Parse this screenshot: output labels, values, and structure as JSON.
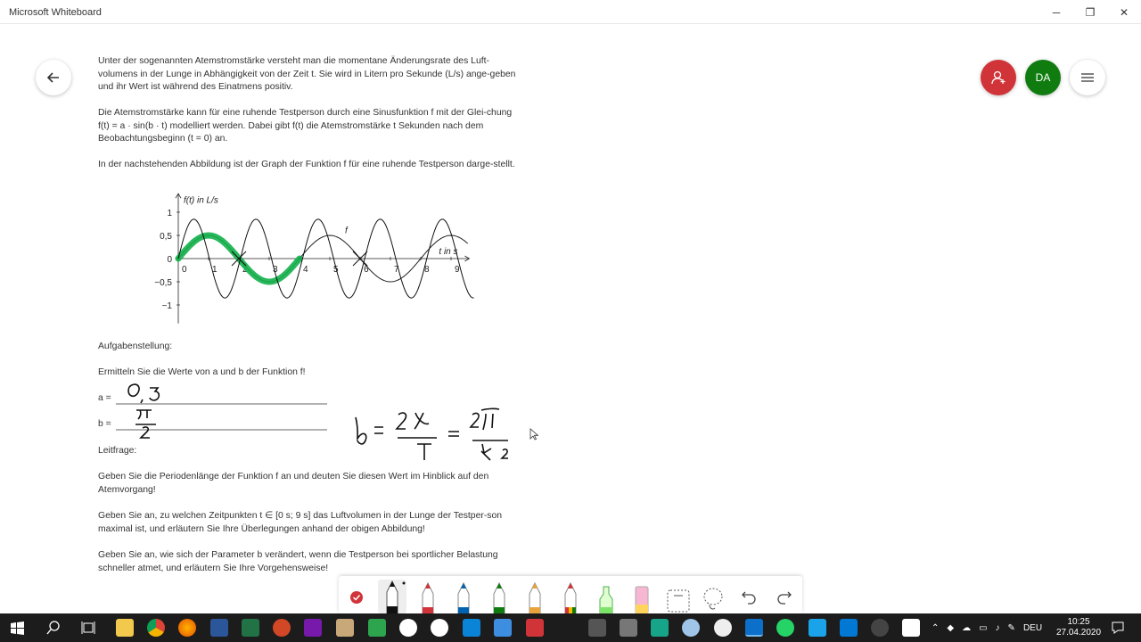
{
  "window": {
    "title": "Microsoft Whiteboard",
    "minimize": "─",
    "restore": "❐",
    "close": "✕"
  },
  "header": {
    "avatar_initials": "DA"
  },
  "doc": {
    "p1": "Unter der sogenannten Atemstromstärke versteht man die momentane Änderungsrate des Luft-volumens in der Lunge in Abhängigkeit von der Zeit t. Sie wird in Litern pro Sekunde (L/s) ange-geben und ihr Wert ist während des Einatmens positiv.",
    "p2": "Die Atemstromstärke kann für eine ruhende Testperson durch eine Sinusfunktion f mit der Glei-chung f(t) = a · sin(b · t) modelliert werden. Dabei gibt f(t) die Atemstromstärke t Sekunden nach dem Beobachtungsbeginn (t = 0) an.",
    "p3": "In der nachstehenden Abbildung ist der Graph der Funktion f für eine ruhende Testperson darge-stellt.",
    "task_heading": "Aufgabenstellung:",
    "task": "Ermitteln Sie die Werte von a und b der Funktion f!",
    "a_label": "a =",
    "b_label": "b =",
    "lead_heading": "Leitfrage:",
    "q1": "Geben Sie die Periodenlänge der Funktion f an und deuten Sie diesen Wert im Hinblick auf den Atemvorgang!",
    "q2": "Geben Sie an, zu welchen Zeitpunkten t ∈ [0 s; 9 s] das Luftvolumen in der Lunge der Testper-son maximal ist, und erläutern Sie Ihre Überlegungen anhand der obigen Abbildung!",
    "q3": "Geben Sie an, wie sich der Parameter b verändert, wenn die Testperson bei sportlicher Belastung schneller atmet, und erläutern Sie Ihre Vorgehensweise!"
  },
  "chart_data": {
    "type": "line",
    "ylabel": "f(t) in L/s",
    "xlabel": "t in s",
    "series_label": "f",
    "x_ticks": [
      "0",
      "1",
      "2",
      "3",
      "4",
      "5",
      "6",
      "7",
      "8",
      "9"
    ],
    "y_ticks": [
      "1",
      "0,5",
      "0",
      "−0,5",
      "−1"
    ],
    "xlim": [
      0,
      9.5
    ],
    "ylim": [
      -1.2,
      1.3
    ],
    "series": [
      {
        "amplitude": 0.5,
        "period": 4
      }
    ]
  },
  "handwriting": {
    "a_value": "0,5",
    "b_value": "π/2",
    "b_equation": "b = 2π/T = 2π/4·2"
  },
  "taskbar": {
    "lang": "DEU",
    "time": "10:25",
    "date": "27.04.2020"
  },
  "colors": {
    "accent_red": "#d13438",
    "avatar_green": "#107c10",
    "ink_green": "#12b04a",
    "taskbar": "#1c1c1c"
  }
}
